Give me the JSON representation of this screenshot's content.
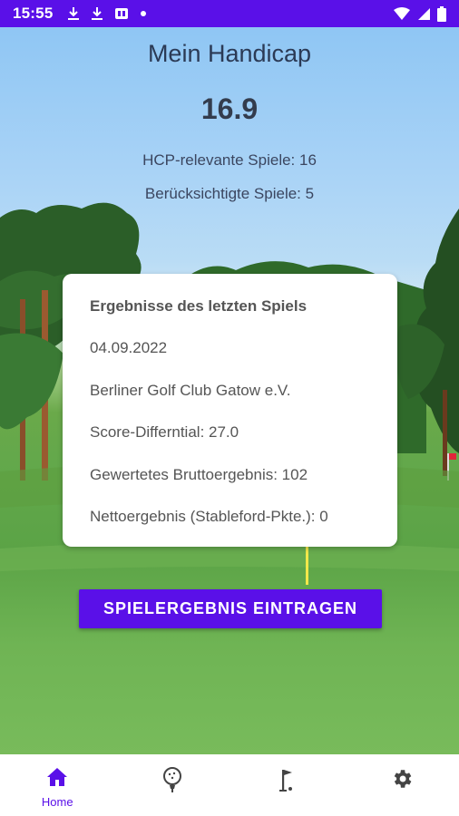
{
  "status_bar": {
    "time": "15:55",
    "left_icons": [
      "download-icon",
      "download-icon",
      "sim-icon",
      "dot-icon"
    ],
    "right_icons": [
      "wifi-icon",
      "signal-icon",
      "battery-icon"
    ],
    "background": "#5a10e8"
  },
  "header": {
    "title": "Mein Handicap",
    "handicap_value": "16.9",
    "relevant_games": "HCP-relevante Spiele: 16",
    "considered_games": "Berücksichtigte Spiele: 5"
  },
  "card": {
    "title": "Ergebnisse des letzten Spiels",
    "date": "04.09.2022",
    "club": "Berliner Golf Club Gatow e.V.",
    "score_differential": "Score-Differntial:  27.0",
    "gross_result": "Gewertetes Bruttoergebnis:  102",
    "net_result": "Nettoergebnis (Stableford-Pkte.):  0"
  },
  "action_button": {
    "label": "SPIELERGEBNIS EINTRAGEN"
  },
  "bottom_nav": {
    "items": [
      {
        "icon": "home-icon",
        "label": "Home",
        "active": true
      },
      {
        "icon": "golf-ball-icon",
        "label": "",
        "active": false
      },
      {
        "icon": "golf-flag-icon",
        "label": "",
        "active": false
      },
      {
        "icon": "settings-icon",
        "label": "",
        "active": false
      }
    ]
  },
  "colors": {
    "accent": "#5a10e8",
    "text_dark": "#2b3a55",
    "inactive_icon": "#444444"
  }
}
